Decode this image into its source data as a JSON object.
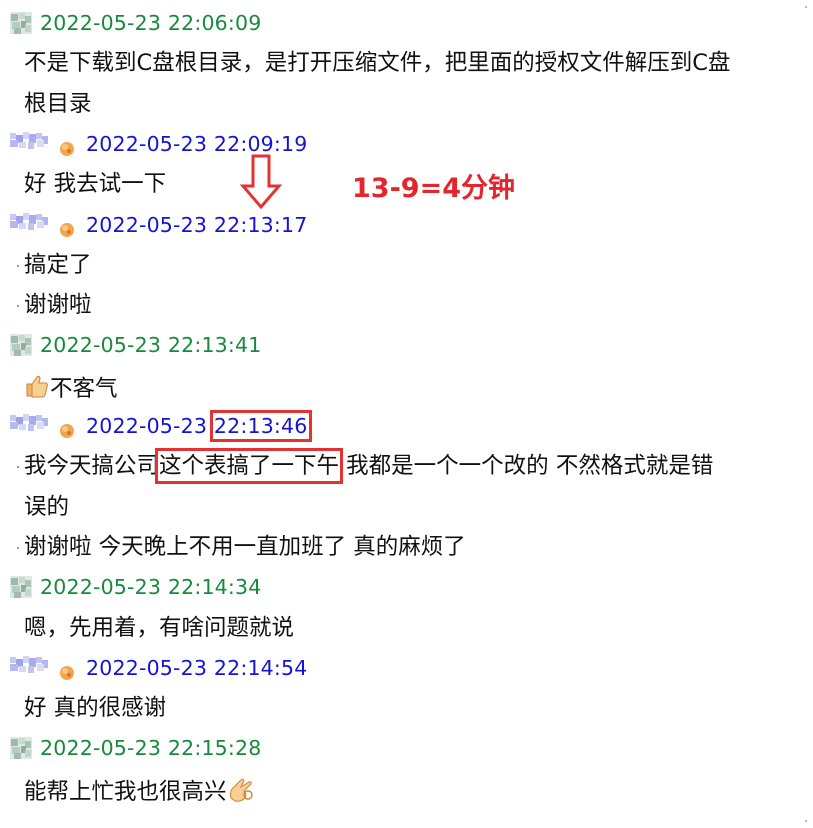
{
  "messages": [
    {
      "type": "header",
      "sender": "self",
      "time": "2022-05-23 22:06:09"
    },
    {
      "type": "text",
      "text": "不是下载到C盘根目录，是打开压缩文件，把里面的授权文件解压到C盘"
    },
    {
      "type": "text",
      "text": "根目录"
    },
    {
      "type": "header",
      "sender": "other",
      "time": "2022-05-23 22:09:19"
    },
    {
      "type": "text",
      "text": "好 我去试一下"
    },
    {
      "type": "header",
      "sender": "other",
      "time": "2022-05-23 22:13:17"
    },
    {
      "type": "text",
      "text": "搞定了"
    },
    {
      "type": "text",
      "text": "谢谢啦"
    },
    {
      "type": "header",
      "sender": "self",
      "time": "2022-05-23 22:13:41"
    },
    {
      "type": "text",
      "text": "不客气",
      "emoji": "thumbs-up-icon"
    },
    {
      "type": "header",
      "sender": "other",
      "time_date": "2022-05-23 ",
      "time_clock": "22:13:46"
    },
    {
      "type": "text",
      "pre": "我今天搞公司",
      "boxed": "这个表搞了一下午",
      "post": " 我都是一个一个改的 不然格式就是错"
    },
    {
      "type": "text",
      "text": "误的"
    },
    {
      "type": "text",
      "text": "谢谢啦 今天晚上不用一直加班了 真的麻烦了"
    },
    {
      "type": "header",
      "sender": "self",
      "time": "2022-05-23 22:14:34"
    },
    {
      "type": "text",
      "text": "嗯，先用着，有啥问题就说"
    },
    {
      "type": "header",
      "sender": "other",
      "time": "2022-05-23 22:14:54"
    },
    {
      "type": "text",
      "text": "好 真的很感谢"
    },
    {
      "type": "header",
      "sender": "self",
      "time": "2022-05-23 22:15:28"
    },
    {
      "type": "text",
      "text": "能帮上忙我也很高兴",
      "emoji": "ok-hand-icon"
    }
  ],
  "annotation": {
    "text": "13-9=4分钟",
    "color": "#e4262c"
  },
  "colors": {
    "self_time": "#188a3c",
    "other_time": "#1414d6",
    "highlight": "#e33232"
  }
}
